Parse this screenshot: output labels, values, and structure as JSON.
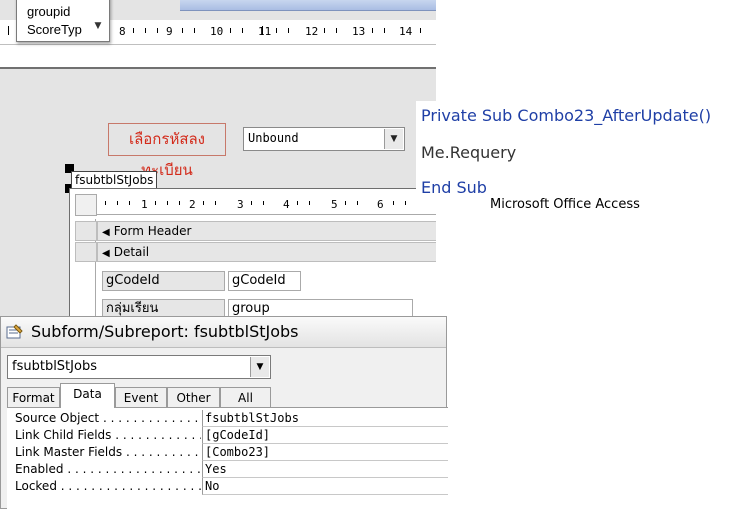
{
  "field_list": {
    "items": [
      "groupid",
      "ScoreTyp"
    ]
  },
  "top_ruler": {
    "numbers": [
      "8",
      "9",
      "10",
      "11",
      "12",
      "13",
      "14"
    ]
  },
  "form": {
    "label_text": "เลือกรหัสลงทะเบียน",
    "combo_value": "Unbound",
    "subform_tag": "fsubtblStJobs"
  },
  "subform": {
    "ruler_numbers": [
      "1",
      "2",
      "3",
      "4",
      "5",
      "6"
    ],
    "sections": {
      "form_header": "Form Header",
      "detail": "Detail"
    },
    "fields": [
      {
        "label": "gCodeId",
        "control": "gCodeId"
      },
      {
        "label": "กลุ่มเรียน",
        "control": "group"
      }
    ]
  },
  "code": {
    "lines": [
      "Private Sub Combo23_AfterUpdate()",
      "Me.Requery",
      "End Sub"
    ],
    "colors": {
      "keyword": "#1f3fa6",
      "text": "#1f3fa6",
      "plain": "#333333"
    },
    "taskbar_ghost": "Microsoft Office Access"
  },
  "property_sheet": {
    "title": "Subform/Subreport: fsubtblStJobs",
    "object": "fsubtblStJobs",
    "tabs": [
      "Format",
      "Data",
      "Event",
      "Other",
      "All"
    ],
    "active_tab": "Data",
    "rows": [
      {
        "name": "Source Object",
        "value": "fsubtblStJobs"
      },
      {
        "name": "Link Child Fields",
        "value": "[gCodeId]"
      },
      {
        "name": "Link Master Fields",
        "value": "[Combo23]"
      },
      {
        "name": "Enabled",
        "value": "Yes"
      },
      {
        "name": "Locked",
        "value": "No"
      }
    ]
  }
}
